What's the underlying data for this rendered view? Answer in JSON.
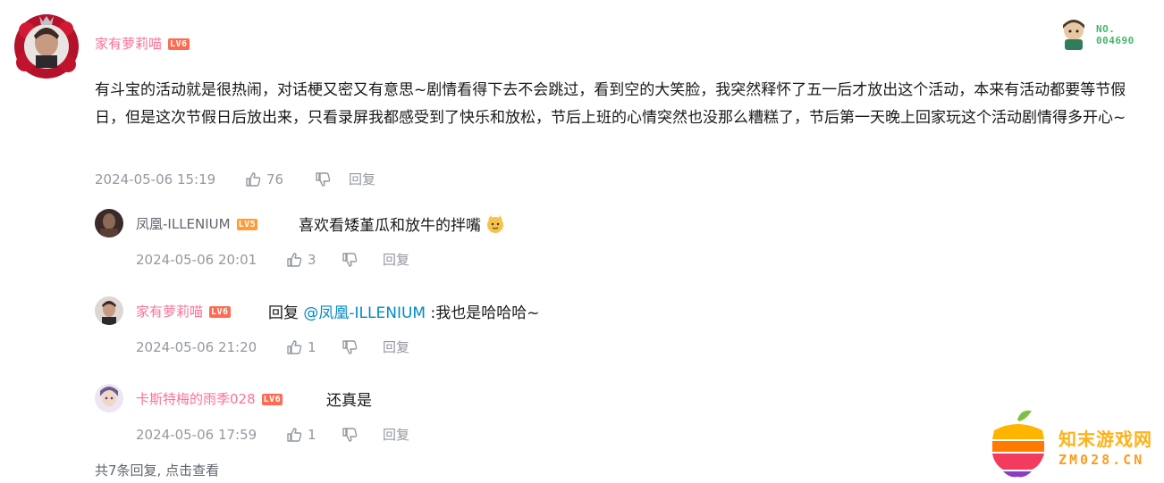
{
  "main_comment": {
    "user": "家有萝莉喵",
    "level": "LV6",
    "text": "有斗宝的活动就是很热闹，对话梗又密又有意思~剧情看得下去不会跳过，看到空的大笑脸，我突然释怀了五一后才放出这个活动，本来有活动都要等节假日，但是这次节假日后放出来，只看录屏我都感受到了快乐和放松，节后上班的心情突然也没那么糟糕了，节后第一天晚上回家玩这个活动剧情得多开心~",
    "time": "2024-05-06 15:19",
    "likes": "76",
    "reply_label": "回复"
  },
  "fan_badge": {
    "label": "NO.",
    "number": "004690"
  },
  "replies": [
    {
      "user": "凤凰-ILLENIUM",
      "level": "LV5",
      "text": "喜欢看矮堇瓜和放牛的拌嘴",
      "time": "2024-05-06 20:01",
      "likes": "3",
      "reply_label": "回复"
    },
    {
      "user": "家有萝莉喵",
      "level": "LV6",
      "reply_prefix": "回复",
      "mention": "@凤凰-ILLENIUM",
      "text": ":我也是哈哈哈~",
      "time": "2024-05-06 21:20",
      "likes": "1",
      "reply_label": "回复"
    },
    {
      "user": "卡斯特梅的雨季028",
      "level": "LV6",
      "text": "还真是",
      "time": "2024-05-06 17:59",
      "likes": "1",
      "reply_label": "回复"
    }
  ],
  "footer": {
    "text": "共7条回复, 点击查看"
  },
  "watermark": {
    "cn": "知末游戏网",
    "en": "ZM028.CN"
  },
  "colors": {
    "username_pink": "#fb7299",
    "mention_blue": "#008ac5",
    "meta_gray": "#9499a0",
    "level_red": "#ff6b52",
    "watermark_orange": "#ffb119"
  }
}
